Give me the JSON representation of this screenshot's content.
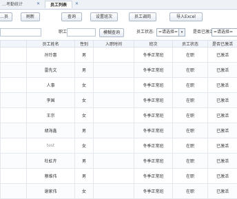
{
  "tabs": [
    {
      "label": "…考勤统计",
      "closable": true
    },
    {
      "label": "员工列表",
      "closable": true,
      "active": true
    }
  ],
  "close_glyph": "✕",
  "toolbar": {
    "buttons": [
      "…员",
      "刷新",
      "查询",
      "设置班次",
      "员工调岗",
      "导入Excel"
    ]
  },
  "filters": {
    "search_placeholder": "",
    "name_label": "职工:",
    "name_value": "",
    "search_button": "模糊查询",
    "status_label": "员工状态:",
    "status_value": "=请选择=",
    "activated_label": "是否已激活:",
    "activated_value": "=请选择=",
    "dropdown_arrow": "▾"
  },
  "table": {
    "columns": [
      "",
      "员工姓名",
      "性别",
      "入职时间",
      "班次",
      "员工状态",
      "是否已激活"
    ],
    "rows": [
      [
        "",
        "孙玲惠",
        "男",
        "",
        "冬季正常班",
        "在职",
        "已激活"
      ],
      [
        "",
        "雷先文",
        "男",
        "",
        "冬季正常班",
        "在职",
        "已激活"
      ],
      [
        "",
        "人事",
        "女",
        "",
        "冬季正常班",
        "在职",
        "已激活"
      ],
      [
        "",
        "李国",
        "女",
        "",
        "冬季正常班",
        "在职",
        "已激活"
      ],
      [
        "",
        "王宗",
        "女",
        "",
        "冬季正常班",
        "在职",
        "已激活"
      ],
      [
        "",
        "胡海鑫",
        "男",
        "",
        "冬季正常班",
        "在职",
        "已激活"
      ],
      [
        "",
        "test",
        "女",
        "",
        "冬季正常班",
        "在职",
        "已激活"
      ],
      [
        "",
        "杜虹卉",
        "男",
        "",
        "冬季正常班",
        "在职",
        "已激活"
      ],
      [
        "",
        "蔡维伟",
        "男",
        "",
        "冬季正常班",
        "在职",
        "已激活"
      ],
      [
        "",
        "谢家伟",
        "女",
        "",
        "冬季正常班",
        "在职",
        "已激活"
      ]
    ]
  }
}
